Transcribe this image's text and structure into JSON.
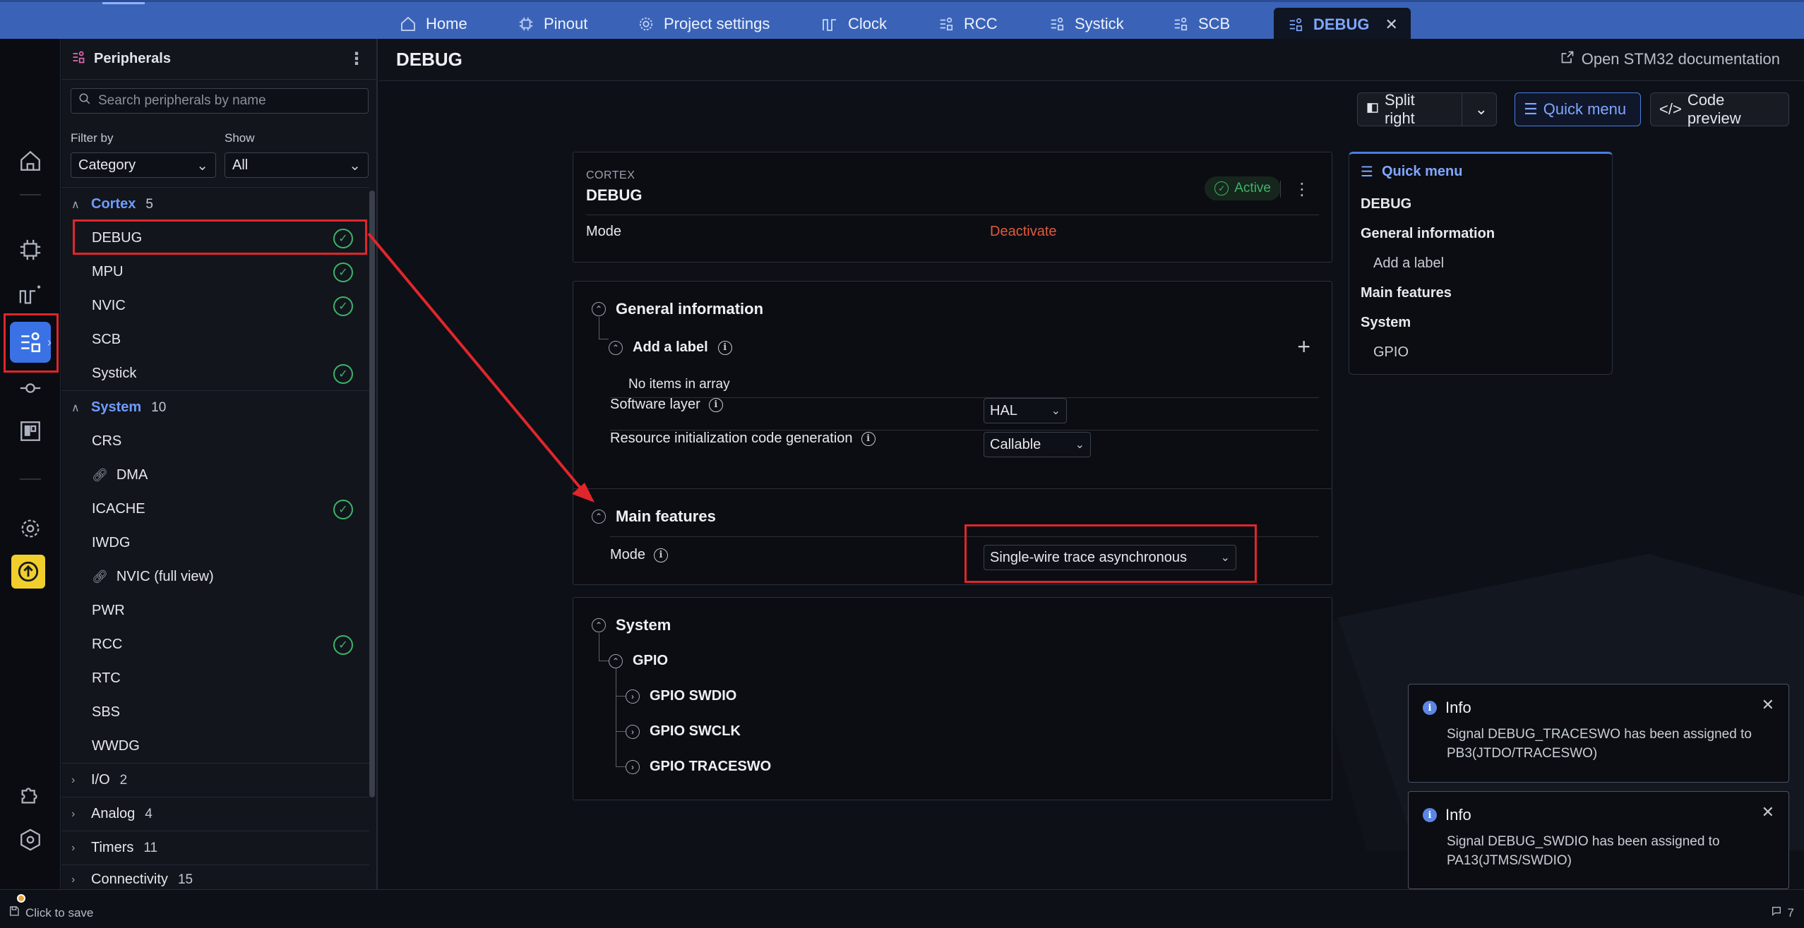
{
  "tabs": [
    {
      "label": "Home",
      "icon": "home-icon"
    },
    {
      "label": "Pinout",
      "icon": "chip-icon"
    },
    {
      "label": "Project settings",
      "icon": "settings-icon"
    },
    {
      "label": "Clock",
      "icon": "clock-wave-icon"
    },
    {
      "label": "RCC",
      "icon": "peripheral-icon"
    },
    {
      "label": "Systick",
      "icon": "peripheral-icon"
    },
    {
      "label": "SCB",
      "icon": "peripheral-icon"
    },
    {
      "label": "DEBUG",
      "icon": "peripheral-icon",
      "active": true
    }
  ],
  "sidebar": {
    "title": "Peripherals",
    "search_placeholder": "Search peripherals by name",
    "filter_label": "Filter by",
    "filter_value": "Category",
    "show_label": "Show",
    "show_value": "All",
    "groups": [
      {
        "name": "Cortex",
        "count": "5",
        "expanded": true,
        "items": [
          {
            "label": "DEBUG",
            "checked": true
          },
          {
            "label": "MPU",
            "checked": true
          },
          {
            "label": "NVIC",
            "checked": true
          },
          {
            "label": "SCB",
            "checked": false
          },
          {
            "label": "Systick",
            "checked": true
          }
        ]
      },
      {
        "name": "System",
        "count": "10",
        "expanded": true,
        "items": [
          {
            "label": "CRS",
            "checked": false
          },
          {
            "label": "DMA",
            "checked": false,
            "link": true
          },
          {
            "label": "ICACHE",
            "checked": true
          },
          {
            "label": "IWDG",
            "checked": false
          },
          {
            "label": "NVIC (full view)",
            "checked": false,
            "link": true
          },
          {
            "label": "PWR",
            "checked": false
          },
          {
            "label": "RCC",
            "checked": true
          },
          {
            "label": "RTC",
            "checked": false
          },
          {
            "label": "SBS",
            "checked": false
          },
          {
            "label": "WWDG",
            "checked": false
          }
        ]
      },
      {
        "name": "I/O",
        "count": "2",
        "expanded": false
      },
      {
        "name": "Analog",
        "count": "4",
        "expanded": false
      },
      {
        "name": "Timers",
        "count": "11",
        "expanded": false
      },
      {
        "name": "Connectivity",
        "count": "15",
        "expanded": false
      }
    ]
  },
  "main": {
    "title": "DEBUG",
    "doc_link": "Open STM32 documentation",
    "split_label": "Split right",
    "quick_menu_label": "Quick menu",
    "code_preview_label": "Code preview",
    "cortex_label": "CORTEX",
    "cortex_title": "DEBUG",
    "active_label": "Active",
    "mode_label": "Mode",
    "deactivate_label": "Deactivate",
    "general_info": "General information",
    "add_label": "Add a label",
    "no_items": "No items in array",
    "software_layer": "Software layer",
    "software_layer_value": "HAL",
    "resource_init": "Resource initialization code generation",
    "resource_init_value": "Callable",
    "main_features": "Main features",
    "features_mode_label": "Mode",
    "features_mode_value": "Single-wire trace asynchronous",
    "system_title": "System",
    "gpio_title": "GPIO",
    "gpio_items": [
      "GPIO SWDIO",
      "GPIO SWCLK",
      "GPIO TRACESWO"
    ]
  },
  "quick_menu": {
    "title": "Quick menu",
    "items": [
      "DEBUG",
      "General information",
      "Add a label",
      "Main features",
      "System",
      "GPIO"
    ]
  },
  "toasts": [
    {
      "title": "Info",
      "body": "Signal DEBUG_TRACESWO has been assigned to PB3(JTDO/TRACESWO)"
    },
    {
      "title": "Info",
      "body": "Signal DEBUG_SWDIO has been assigned to PA13(JTMS/SWDIO)"
    }
  ],
  "status": {
    "save": "Click to save",
    "notif_count": "7"
  },
  "colors": {
    "accent": "#6f9cff",
    "tabbar": "#3a63b8",
    "active_green": "#3bb46a",
    "deactivate": "#e05a3d",
    "highlight": "#e0262b"
  }
}
